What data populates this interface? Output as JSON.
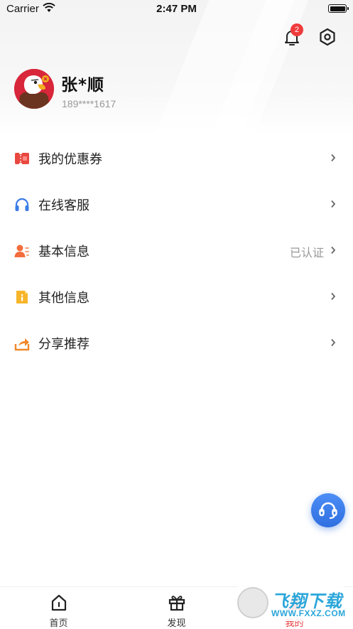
{
  "status_bar": {
    "carrier": "Carrier",
    "time": "2:47 PM"
  },
  "header": {
    "notification_count": "2"
  },
  "user": {
    "name": "张*顺",
    "phone": "189****1617"
  },
  "menu": [
    {
      "label": "我的优惠券",
      "value": "",
      "icon": "coupon-icon"
    },
    {
      "label": "在线客服",
      "value": "",
      "icon": "headset-icon"
    },
    {
      "label": "基本信息",
      "value": "已认证",
      "icon": "user-info-icon"
    },
    {
      "label": "其他信息",
      "value": "",
      "icon": "info-doc-icon"
    },
    {
      "label": "分享推荐",
      "value": "",
      "icon": "share-icon"
    }
  ],
  "tabs": [
    {
      "label": "首页",
      "icon": "home-icon",
      "active": false
    },
    {
      "label": "发现",
      "icon": "gift-icon",
      "active": false
    },
    {
      "label": "我的",
      "icon": "profile-icon",
      "active": true
    }
  ],
  "watermark": {
    "title": "飞翔下载",
    "url": "WWW.FXXZ.COM"
  },
  "colors": {
    "accent_red": "#e83a3a",
    "badge_red": "#ef3b3b",
    "service_blue": "#2f6fe0",
    "value_gray": "#999999"
  }
}
